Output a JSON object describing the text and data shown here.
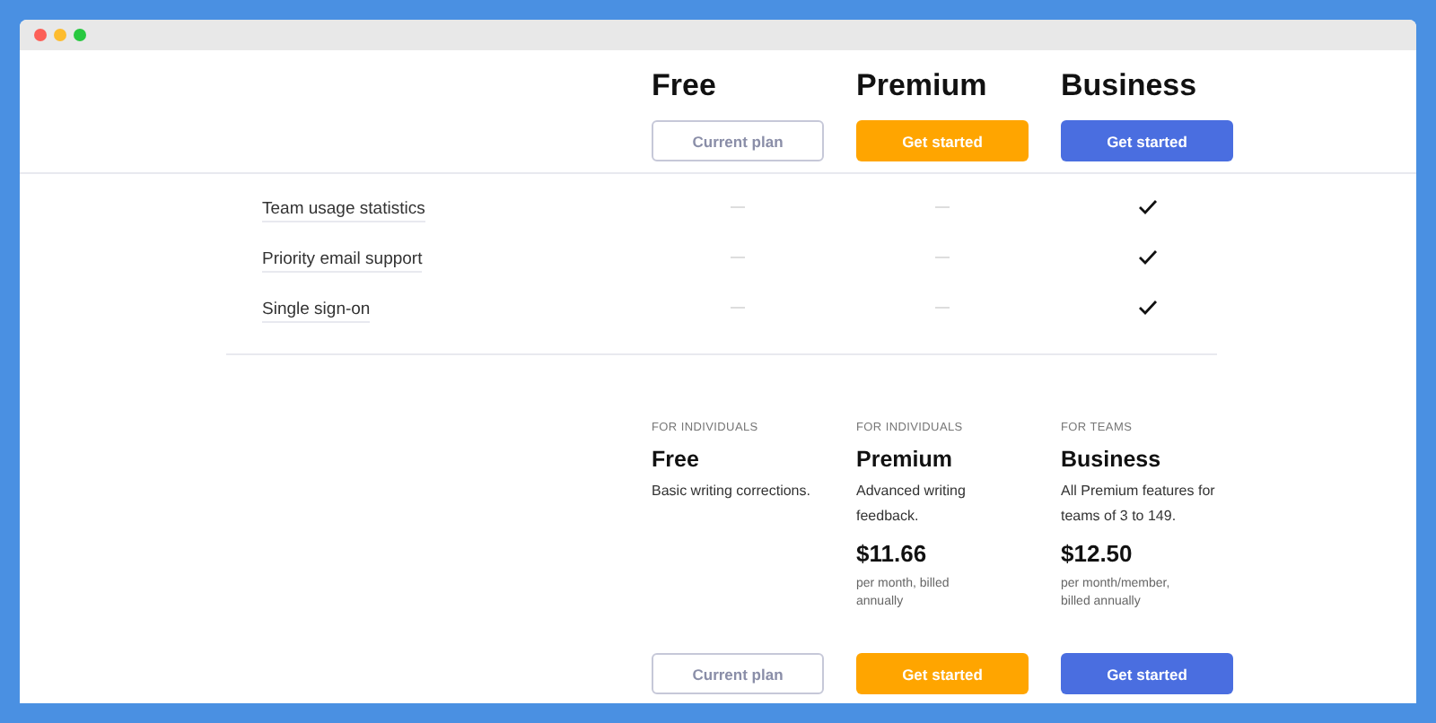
{
  "header_plans": [
    {
      "name": "Free",
      "button": {
        "label": "Current plan",
        "kind": "current"
      }
    },
    {
      "name": "Premium",
      "button": {
        "label": "Get started",
        "kind": "upgrade"
      }
    },
    {
      "name": "Business",
      "button": {
        "label": "Get started",
        "kind": "upgrade"
      }
    }
  ],
  "features": [
    {
      "label": "Team usage statistics",
      "values": [
        {
          "kind": "dash"
        },
        {
          "kind": "dash"
        },
        {
          "kind": "check"
        }
      ]
    },
    {
      "label": "Priority email support",
      "values": [
        {
          "kind": "dash"
        },
        {
          "kind": "dash"
        },
        {
          "kind": "check"
        }
      ]
    },
    {
      "label": "Single sign-on",
      "values": [
        {
          "kind": "dash"
        },
        {
          "kind": "dash"
        },
        {
          "kind": "check"
        }
      ]
    }
  ],
  "plan_cards": [
    {
      "audience": "FOR INDIVIDUALS",
      "name": "Free",
      "description": "Basic writing corrections.",
      "button": {
        "label": "Current plan",
        "kind": "current"
      }
    },
    {
      "audience": "FOR INDIVIDUALS",
      "name": "Premium",
      "description": "Advanced writing feedback.",
      "price": "$11.66",
      "price_note": "per month, billed annually",
      "button": {
        "label": "Get started",
        "kind": "upgrade"
      }
    },
    {
      "audience": "FOR TEAMS",
      "name": "Business",
      "description": "All Premium features for teams of 3 to 149.",
      "price": "$12.50",
      "price_note": "per month/member, billed annually",
      "button": {
        "label": "Get started",
        "kind": "upgrade"
      }
    }
  ]
}
